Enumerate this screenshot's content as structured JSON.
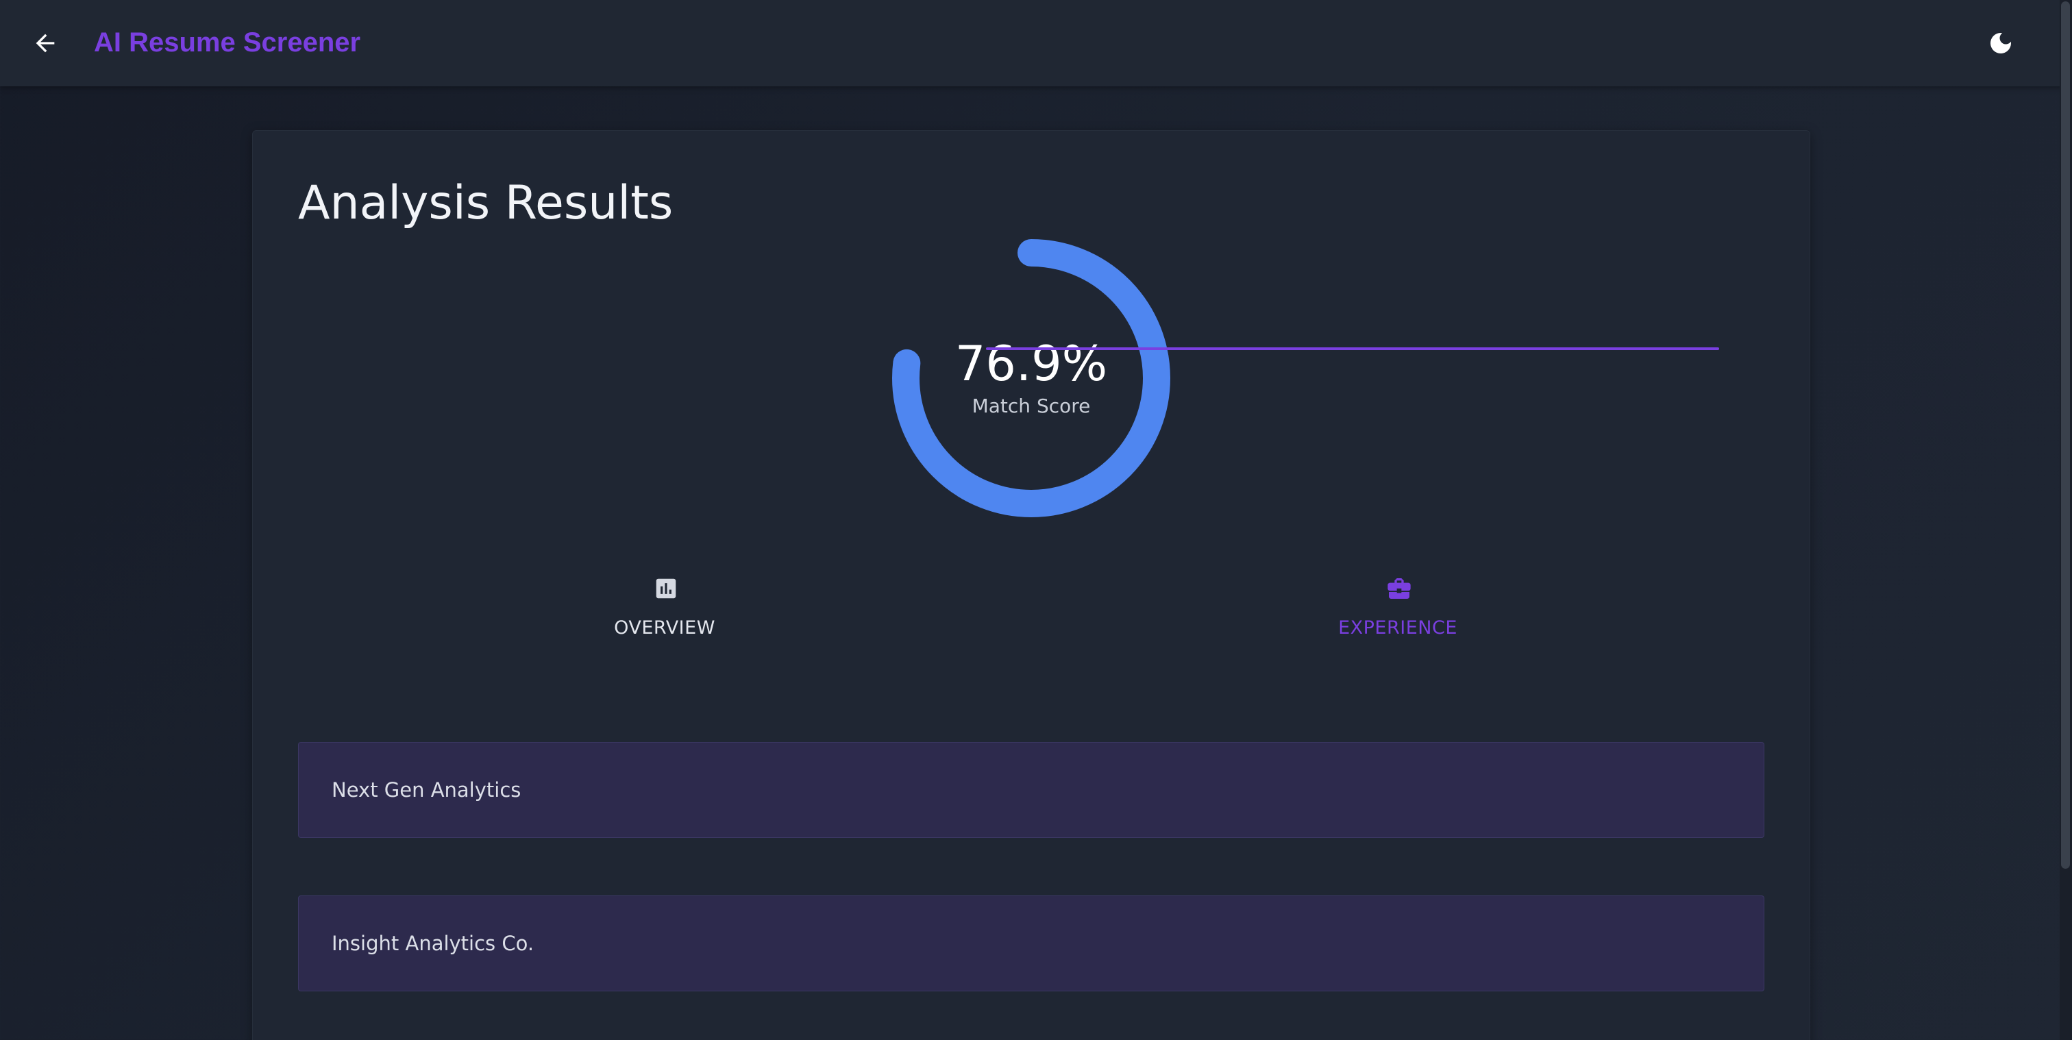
{
  "header": {
    "title": "AI Resume Screener",
    "back_icon": "arrow-left-icon",
    "theme_icon": "moon-icon"
  },
  "main": {
    "title": "Analysis Results",
    "score": {
      "value_text": "76.9%",
      "value": 0.769,
      "label": "Match Score",
      "color": "#4f86f0"
    },
    "tabs": [
      {
        "label": "OVERVIEW",
        "icon": "bar-chart-icon",
        "active": false
      },
      {
        "label": "EXPERIENCE",
        "icon": "briefcase-icon",
        "active": true
      }
    ],
    "experience": [
      {
        "company": "Next Gen Analytics"
      },
      {
        "company": "Insight Analytics Co."
      }
    ]
  },
  "colors": {
    "accent": "#7a3fe0",
    "gauge": "#4f86f0",
    "background": "#1c2330",
    "item_background": "#2d2a4d"
  }
}
